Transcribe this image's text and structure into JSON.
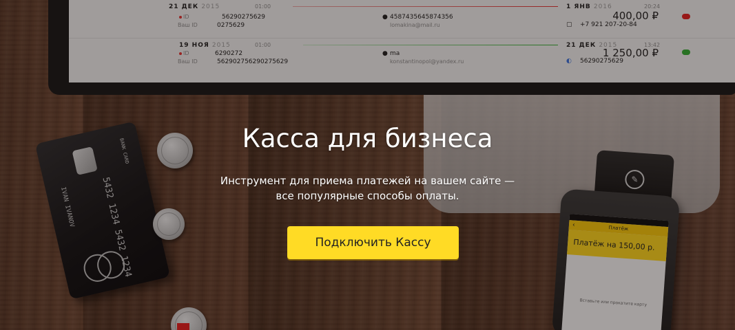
{
  "hero": {
    "title": "Касса для бизнеса",
    "subtitle_line1": "Инструмент для приема платежей на вашем сайте —",
    "subtitle_line2": "все популярные способы оплаты.",
    "cta_label": "Подключить Кассу",
    "cta_color": "#ffdb25"
  },
  "transactions": [
    {
      "date_day": "21 ДЕК",
      "date_year": "2015",
      "start_time": "01:00",
      "end_date_day": "1 ЯНВ",
      "end_date_year": "2016",
      "end_time": "20:24",
      "id_label": "ID",
      "id_value": "56290275629",
      "your_id_label": "Ваш ID",
      "your_id_value": "0275629",
      "payer_id": "4587435645874356",
      "payer_email": "lomakina@mail.ru",
      "amount": "400,00 ₽",
      "phone": "+7 921 207-20-84",
      "status_color": "#dd2222"
    },
    {
      "date_day": "19 НОЯ",
      "date_year": "2015",
      "start_time": "01:00",
      "end_date_day": "21 ДЕК",
      "end_date_year": "2015",
      "end_time": "13:42",
      "id_label": "ID",
      "id_value": "6290272",
      "your_id_label": "Ваш ID",
      "your_id_value": "562902756290275629",
      "payer_id": "ma",
      "payer_email": "konstantinopol@yandex.ru",
      "amount": "1 250,00 ₽",
      "phone": "56290275629",
      "status_color": "#33aa33"
    }
  ],
  "card": {
    "brand": "BANK CARD",
    "number": "5432 1234 5432 1234",
    "holder": "IVAN IVANOV"
  },
  "phone_screen": {
    "back_icon": "‹",
    "title": "Платёж",
    "amount_text": "Платёж на 150,00 р.",
    "hint": "Вставьте или прокатите карту"
  }
}
